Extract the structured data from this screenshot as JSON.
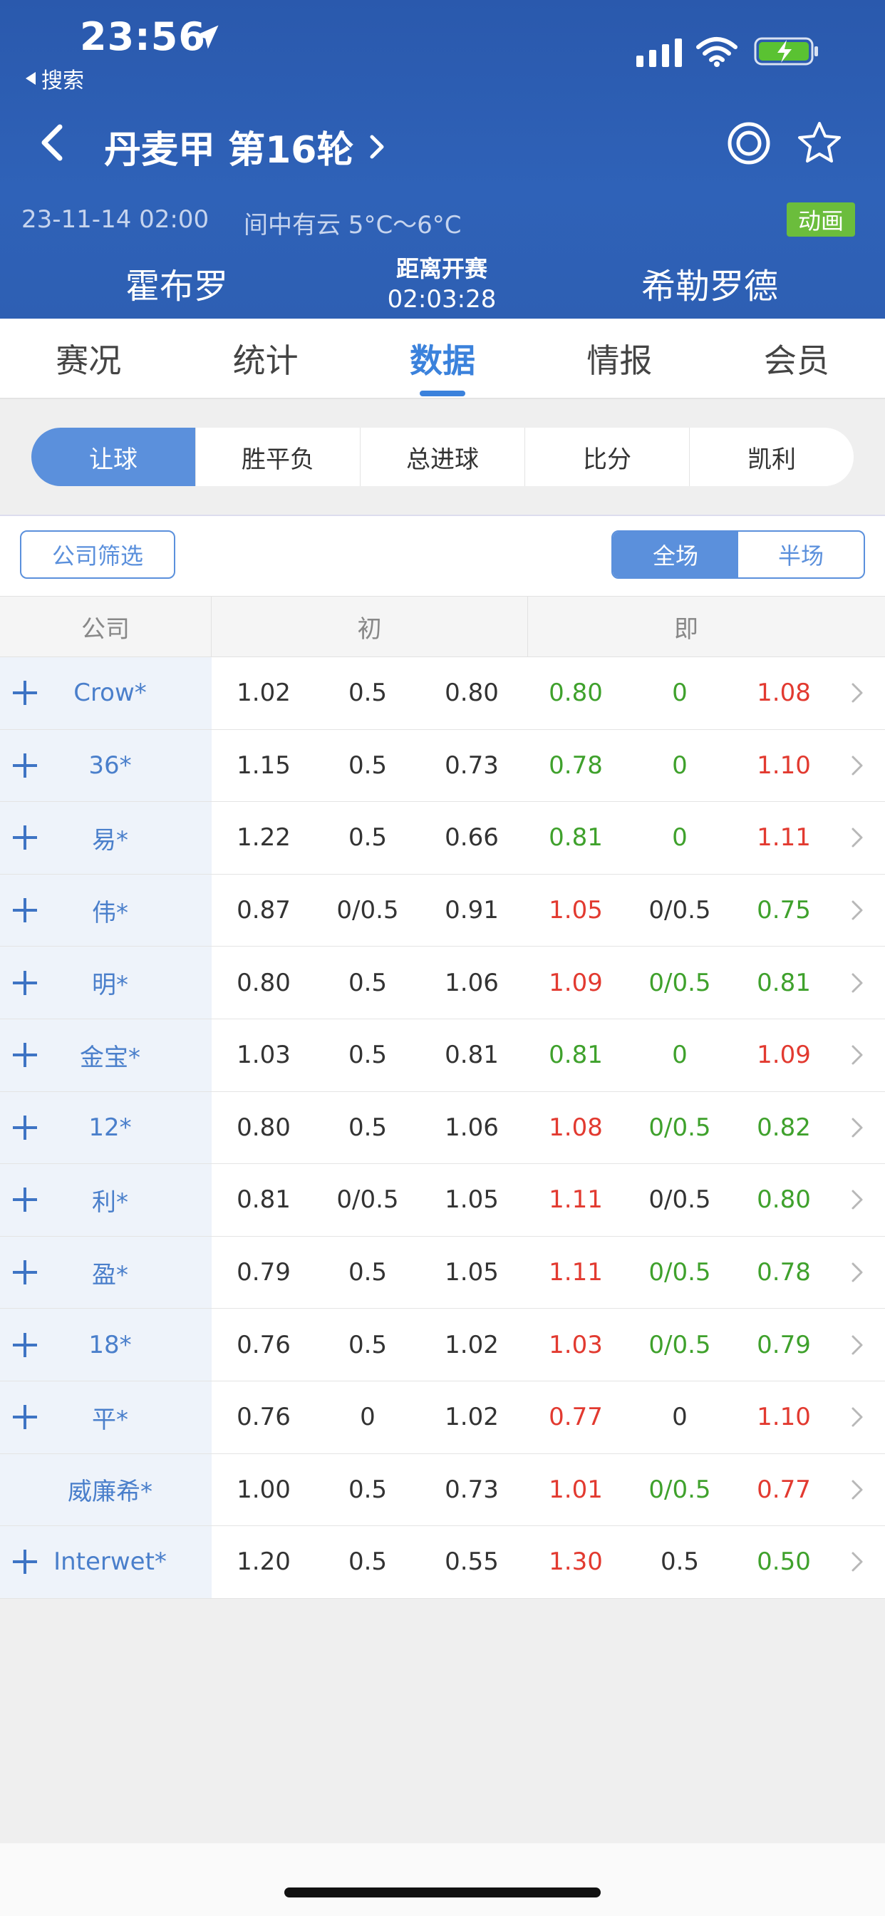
{
  "status_bar": {
    "time": "23:56",
    "back_label": "搜索"
  },
  "header": {
    "title": "丹麦甲 第16轮",
    "date": "23-11-14 02:00",
    "weather": "间中有云 5°C～6°C",
    "anim_badge": "动画",
    "home_team": "霍布罗",
    "away_team": "希勒罗德",
    "kickoff_label": "距离开赛",
    "kickoff_countdown": "02:03:28"
  },
  "main_tabs": [
    {
      "label": "赛况"
    },
    {
      "label": "统计"
    },
    {
      "label": "数据",
      "active": true
    },
    {
      "label": "情报"
    },
    {
      "label": "会员"
    }
  ],
  "bet_types": [
    {
      "label": "让球",
      "active": true
    },
    {
      "label": "胜平负"
    },
    {
      "label": "总进球"
    },
    {
      "label": "比分"
    },
    {
      "label": "凯利"
    }
  ],
  "filter": {
    "company_filter": "公司筛选",
    "full_time": "全场",
    "half_time": "半场"
  },
  "table": {
    "headers": {
      "company": "公司",
      "initial": "初",
      "live": "即"
    },
    "rows": [
      {
        "company": "Crow*",
        "plus": true,
        "init": [
          "1.02",
          "0.5",
          "0.80"
        ],
        "live": [
          "0.80",
          "0",
          "1.08"
        ],
        "live_colors": [
          "green",
          "green",
          "red"
        ]
      },
      {
        "company": "36*",
        "plus": true,
        "init": [
          "1.15",
          "0.5",
          "0.73"
        ],
        "live": [
          "0.78",
          "0",
          "1.10"
        ],
        "live_colors": [
          "green",
          "green",
          "red"
        ]
      },
      {
        "company": "易*",
        "plus": true,
        "init": [
          "1.22",
          "0.5",
          "0.66"
        ],
        "live": [
          "0.81",
          "0",
          "1.11"
        ],
        "live_colors": [
          "green",
          "green",
          "red"
        ]
      },
      {
        "company": "伟*",
        "plus": true,
        "init": [
          "0.87",
          "0/0.5",
          "0.91"
        ],
        "live": [
          "1.05",
          "0/0.5",
          "0.75"
        ],
        "live_colors": [
          "red",
          "black",
          "green"
        ]
      },
      {
        "company": "明*",
        "plus": true,
        "init": [
          "0.80",
          "0.5",
          "1.06"
        ],
        "live": [
          "1.09",
          "0/0.5",
          "0.81"
        ],
        "live_colors": [
          "red",
          "green",
          "green"
        ]
      },
      {
        "company": "金宝*",
        "plus": true,
        "init": [
          "1.03",
          "0.5",
          "0.81"
        ],
        "live": [
          "0.81",
          "0",
          "1.09"
        ],
        "live_colors": [
          "green",
          "green",
          "red"
        ]
      },
      {
        "company": "12*",
        "plus": true,
        "init": [
          "0.80",
          "0.5",
          "1.06"
        ],
        "live": [
          "1.08",
          "0/0.5",
          "0.82"
        ],
        "live_colors": [
          "red",
          "green",
          "green"
        ]
      },
      {
        "company": "利*",
        "plus": true,
        "init": [
          "0.81",
          "0/0.5",
          "1.05"
        ],
        "live": [
          "1.11",
          "0/0.5",
          "0.80"
        ],
        "live_colors": [
          "red",
          "black",
          "green"
        ]
      },
      {
        "company": "盈*",
        "plus": true,
        "init": [
          "0.79",
          "0.5",
          "1.05"
        ],
        "live": [
          "1.11",
          "0/0.5",
          "0.78"
        ],
        "live_colors": [
          "red",
          "green",
          "green"
        ]
      },
      {
        "company": "18*",
        "plus": true,
        "init": [
          "0.76",
          "0.5",
          "1.02"
        ],
        "live": [
          "1.03",
          "0/0.5",
          "0.79"
        ],
        "live_colors": [
          "red",
          "green",
          "green"
        ]
      },
      {
        "company": "平*",
        "plus": true,
        "init": [
          "0.76",
          "0",
          "1.02"
        ],
        "live": [
          "0.77",
          "0",
          "1.10"
        ],
        "live_colors": [
          "red",
          "black",
          "red"
        ]
      },
      {
        "company": "威廉希*",
        "plus": false,
        "init": [
          "1.00",
          "0.5",
          "0.73"
        ],
        "live": [
          "1.01",
          "0/0.5",
          "0.77"
        ],
        "live_colors": [
          "red",
          "green",
          "red"
        ]
      },
      {
        "company": "Interwet*",
        "plus": true,
        "init": [
          "1.20",
          "0.5",
          "0.55"
        ],
        "live": [
          "1.30",
          "0.5",
          "0.50"
        ],
        "live_colors": [
          "red",
          "black",
          "green"
        ]
      }
    ]
  },
  "icons": {
    "location": "location-arrow-icon",
    "signal": "signal-icon",
    "wifi": "wifi-icon",
    "battery": "battery-charging-icon",
    "back": "chevron-left-icon",
    "title_more": "chevron-right-icon",
    "target": "target-icon",
    "favorite": "star-icon",
    "expand": "plus-icon",
    "row_detail": "chevron-right-icon"
  },
  "colors": {
    "header_blue": "#2e5fb3",
    "accent_blue": "#3b82dc",
    "segment_blue": "#5b90dc",
    "odds_green": "#3fa12c",
    "odds_red": "#e23a30",
    "badge_green": "#6bbd3c"
  }
}
